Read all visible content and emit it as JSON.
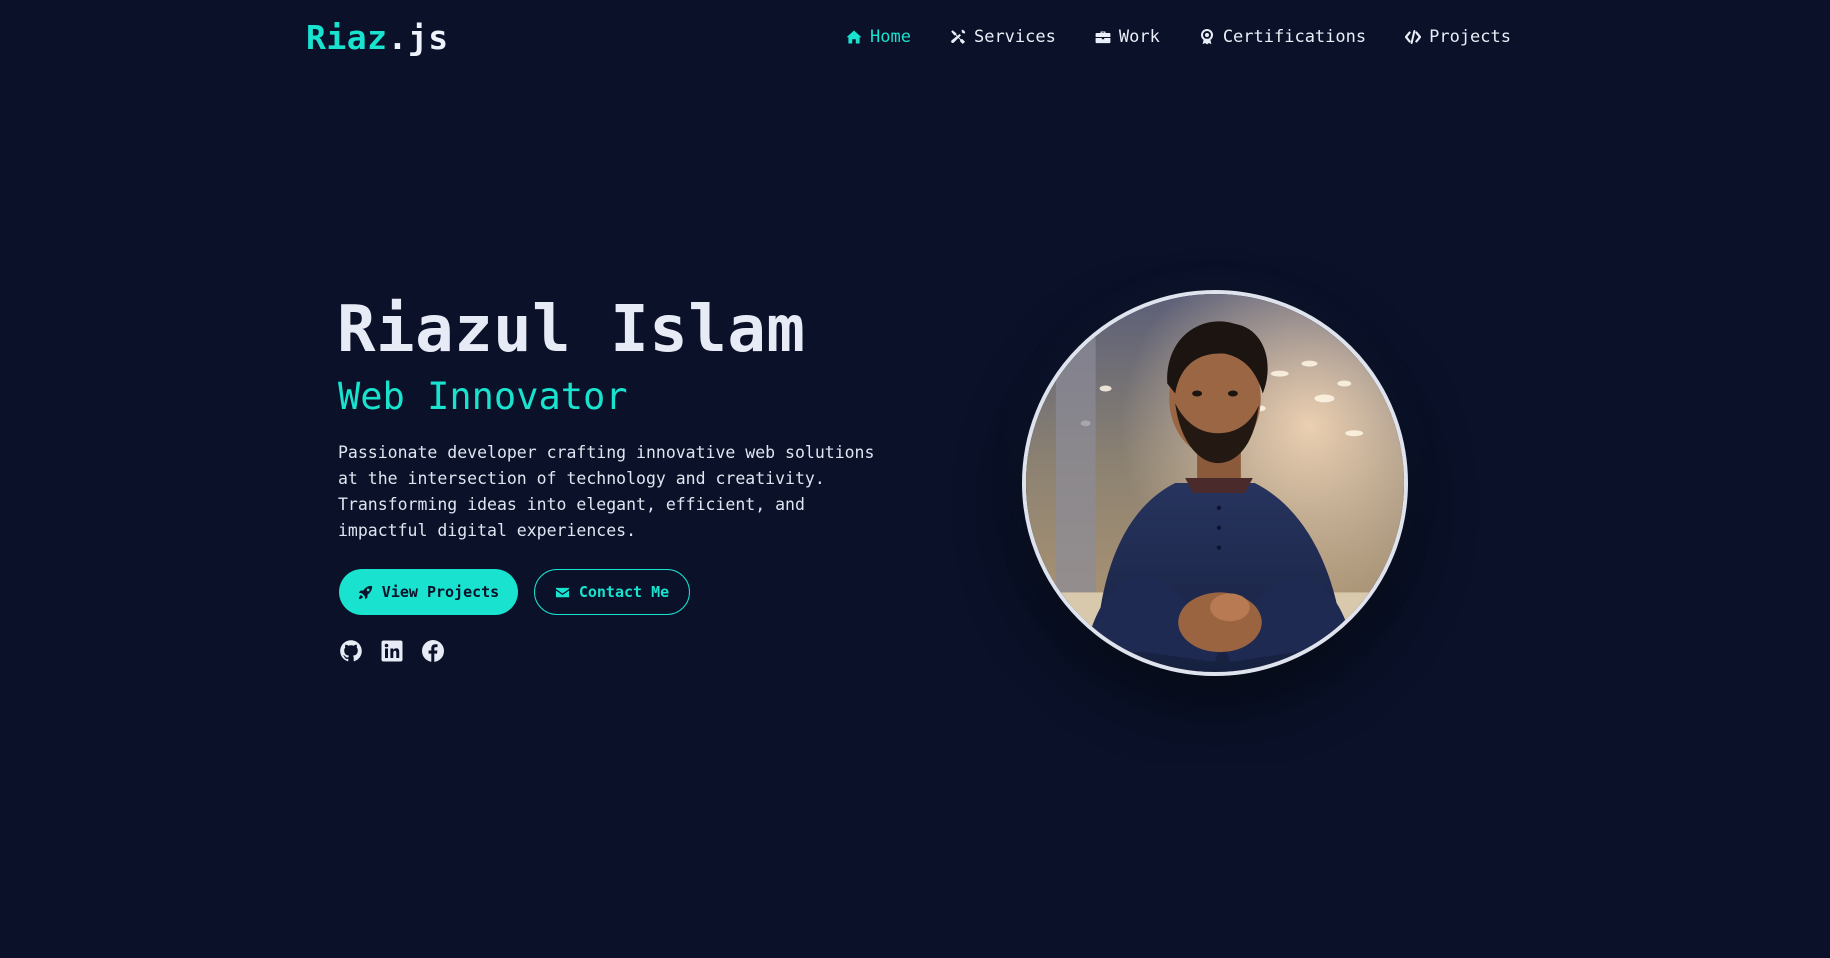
{
  "brand": {
    "logo_accent": "Riaz",
    "logo_rest": ".js",
    "accent_color": "#19e2cf",
    "background_color": "#0a1128"
  },
  "nav": {
    "items": [
      {
        "label": "Home",
        "icon": "home-icon",
        "active": true
      },
      {
        "label": "Services",
        "icon": "tools-icon",
        "active": false
      },
      {
        "label": "Work",
        "icon": "briefcase-icon",
        "active": false
      },
      {
        "label": "Certifications",
        "icon": "award-icon",
        "active": false
      },
      {
        "label": "Projects",
        "icon": "code-icon",
        "active": false
      }
    ]
  },
  "hero": {
    "name": "Riazul Islam",
    "role": "Web Innovator",
    "description": "Passionate developer crafting innovative web solutions at the intersection of technology and creativity. Transforming ideas into elegant, efficient, and impactful digital experiences.",
    "primary_button": {
      "label": "View Projects",
      "icon": "rocket-icon"
    },
    "secondary_button": {
      "label": "Contact Me",
      "icon": "envelope-icon"
    },
    "socials": [
      {
        "icon": "github-icon"
      },
      {
        "icon": "linkedin-icon"
      },
      {
        "icon": "facebook-icon"
      }
    ],
    "portrait": {
      "subject": "profile-photo"
    }
  }
}
